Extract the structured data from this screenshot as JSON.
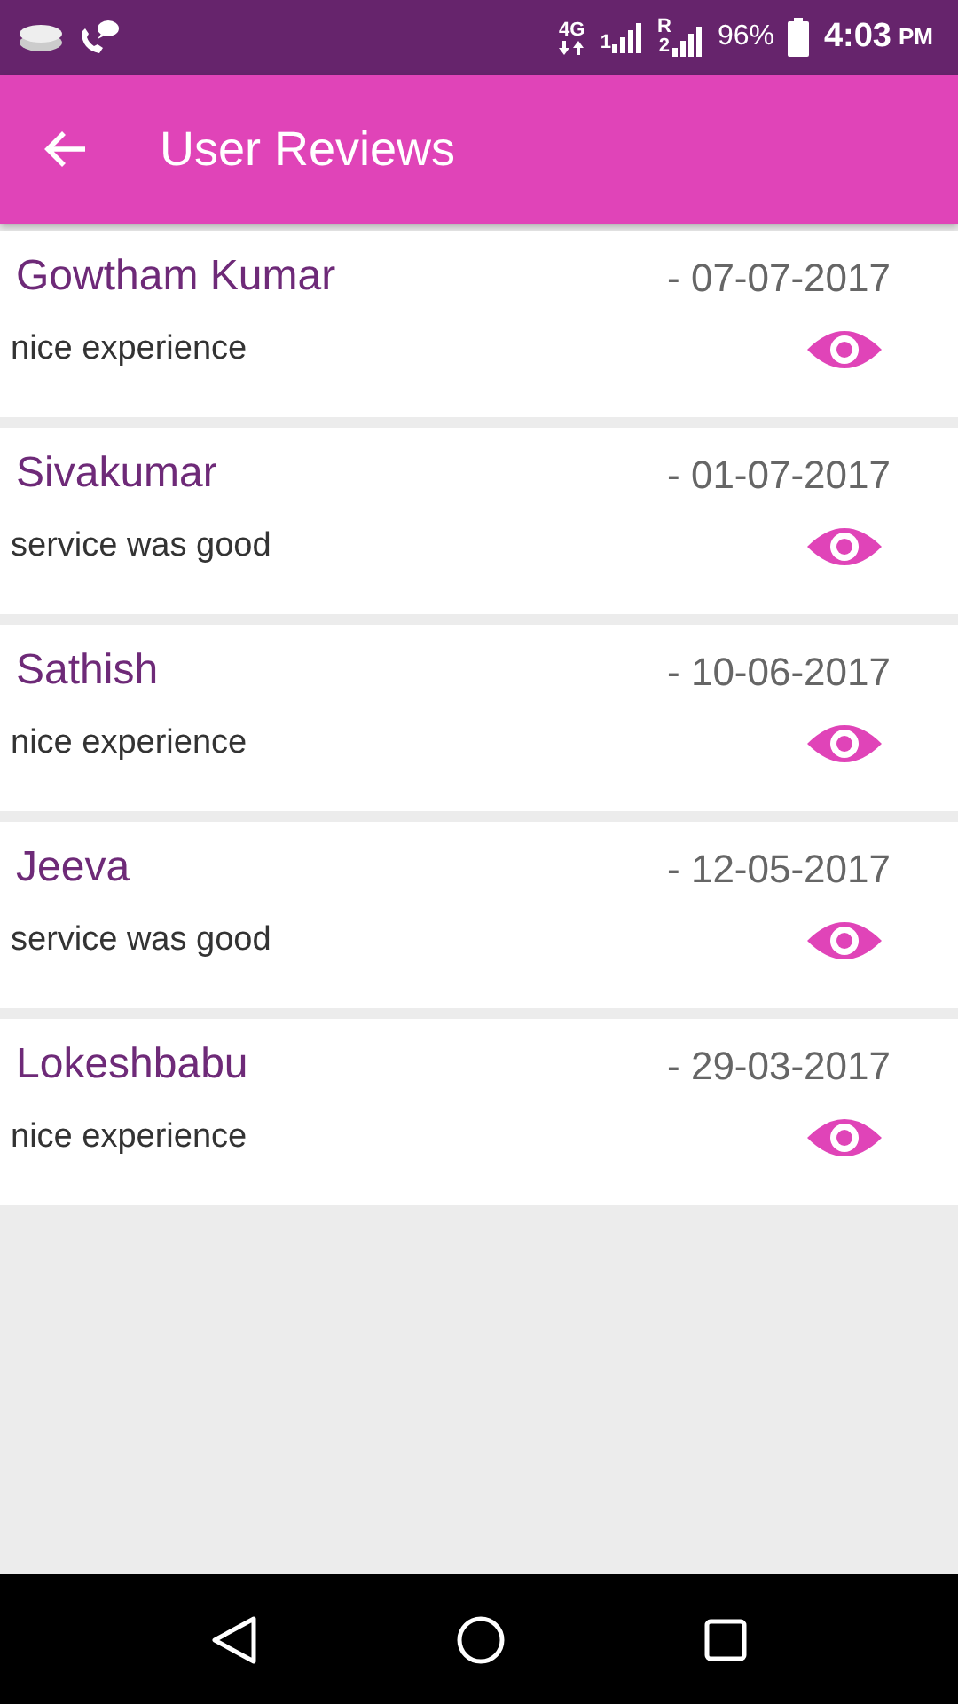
{
  "status_bar": {
    "network": "4G",
    "sim_1": "1",
    "roaming": "R",
    "sim_2": "2",
    "battery": "96%",
    "time": "4:03",
    "am_pm": "PM"
  },
  "app_bar": {
    "title": "User Reviews"
  },
  "reviews": [
    {
      "name": "Gowtham Kumar",
      "date": "- 07-07-2017",
      "comment": "nice experience"
    },
    {
      "name": "Sivakumar",
      "date": "- 01-07-2017",
      "comment": "service was good"
    },
    {
      "name": "Sathish",
      "date": "- 10-06-2017",
      "comment": "nice experience"
    },
    {
      "name": "Jeeva",
      "date": "- 12-05-2017",
      "comment": "service was good"
    },
    {
      "name": "Lokeshbabu",
      "date": "- 29-03-2017",
      "comment": "nice experience"
    }
  ]
}
